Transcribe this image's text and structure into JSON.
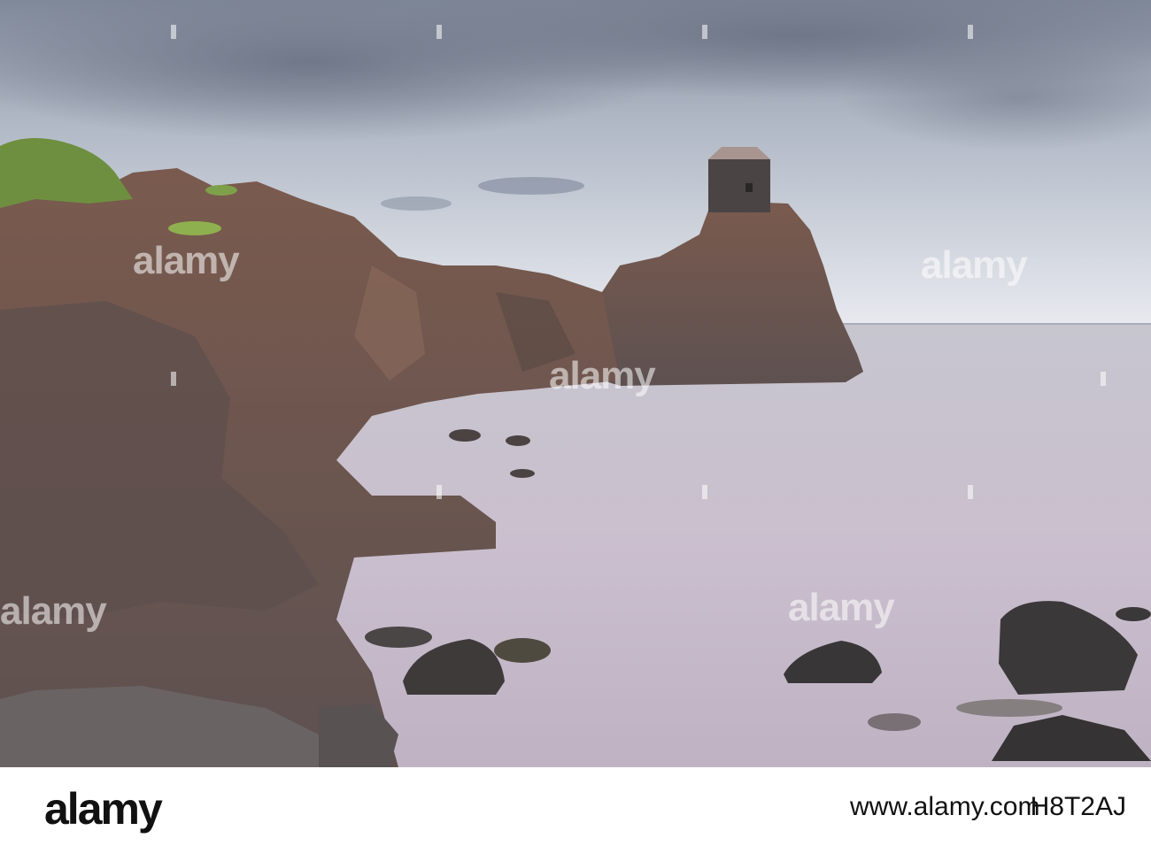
{
  "watermark": {
    "text": "alamy",
    "color": "#ffffff"
  },
  "footer": {
    "logo": "alamy",
    "image_id": "H8T2AJ",
    "domain": "www.alamy.com"
  },
  "colors": {
    "sky_top": "#8a93a3",
    "sky_bottom": "#e6e9ee",
    "sea": "#c9c2cf",
    "rock": "#6e5c58",
    "rock_dark": "#3c3535",
    "grass": "#7ea04a"
  }
}
